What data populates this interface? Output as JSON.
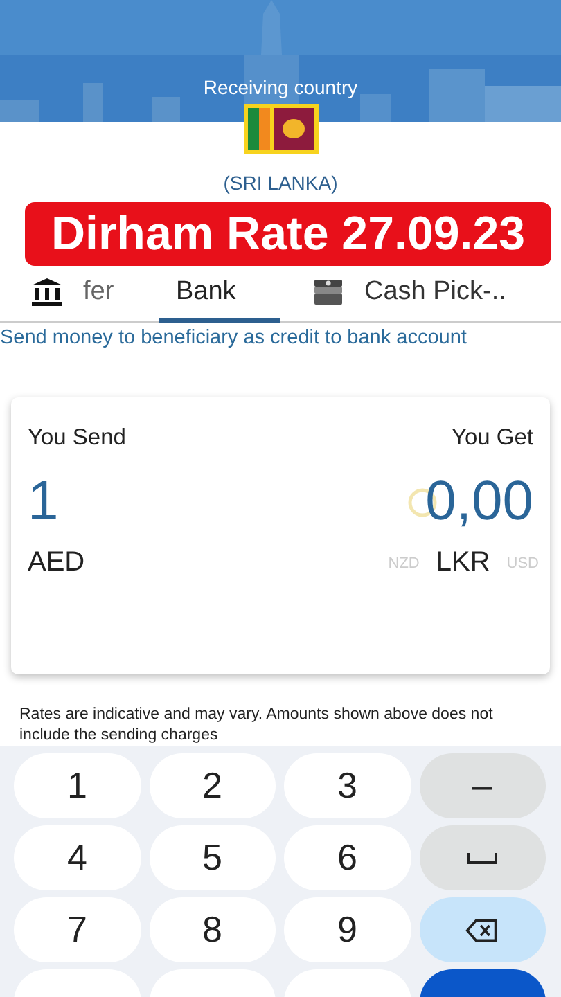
{
  "header": {
    "label": "Receiving country",
    "country": "(SRI LANKA)"
  },
  "banner": "Dirham Rate 27.09.23",
  "tabs": [
    {
      "label": "fer",
      "kind": "bank",
      "selected": false
    },
    {
      "label": "Bank",
      "kind": "plain",
      "selected": true
    },
    {
      "label": "Cash Pick-..",
      "kind": "cash",
      "selected": false
    }
  ],
  "description": "Send money to beneficiary as credit to bank account",
  "converter": {
    "send_label": "You Send",
    "get_label": "You Get",
    "send_amount": "1",
    "get_amount": "0,00",
    "loading": true,
    "send_currency": "AED",
    "get_currencies": [
      {
        "code": "NZD",
        "selected": false
      },
      {
        "code": "LKR",
        "selected": true
      },
      {
        "code": "USD",
        "selected": false
      }
    ]
  },
  "disclaimer": "Rates are indicative and may vary. Amounts shown above does not include the sending charges",
  "keyboard": {
    "keys": [
      {
        "kind": "digit",
        "label": "1"
      },
      {
        "kind": "digit",
        "label": "2"
      },
      {
        "kind": "digit",
        "label": "3"
      },
      {
        "kind": "symbol",
        "label": "–"
      },
      {
        "kind": "digit",
        "label": "4"
      },
      {
        "kind": "digit",
        "label": "5"
      },
      {
        "kind": "digit",
        "label": "6"
      },
      {
        "kind": "space"
      },
      {
        "kind": "digit",
        "label": "7"
      },
      {
        "kind": "digit",
        "label": "8"
      },
      {
        "kind": "digit",
        "label": "9"
      },
      {
        "kind": "backspace"
      },
      {
        "kind": "blank"
      },
      {
        "kind": "blank"
      },
      {
        "kind": "blank"
      },
      {
        "kind": "enter"
      }
    ]
  }
}
